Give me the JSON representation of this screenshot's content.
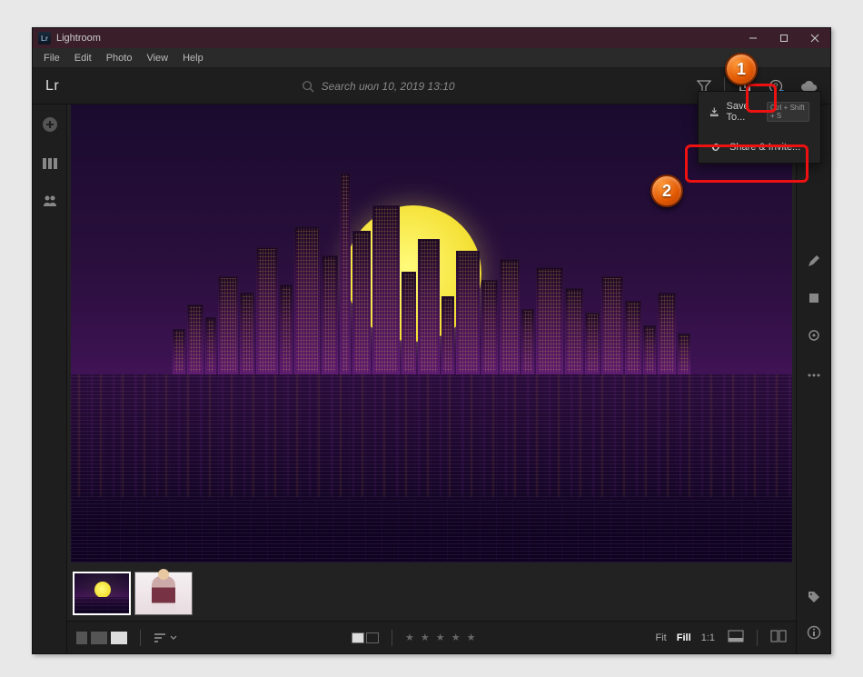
{
  "window": {
    "title": "Lightroom"
  },
  "menus": {
    "file": "File",
    "edit": "Edit",
    "photo": "Photo",
    "view": "View",
    "help": "Help"
  },
  "brand": "Lr",
  "search": {
    "placeholder": "Search июл 10, 2019 13:10"
  },
  "share_menu": {
    "save_to": "Save To...",
    "save_shortcut": "Ctrl + Shift + S",
    "share_invite": "Share & Invite..."
  },
  "bottom": {
    "fit": "Fit",
    "fill": "Fill",
    "ratio": "1:1",
    "stars": "★ ★ ★ ★ ★"
  },
  "callouts": {
    "one": "1",
    "two": "2"
  }
}
